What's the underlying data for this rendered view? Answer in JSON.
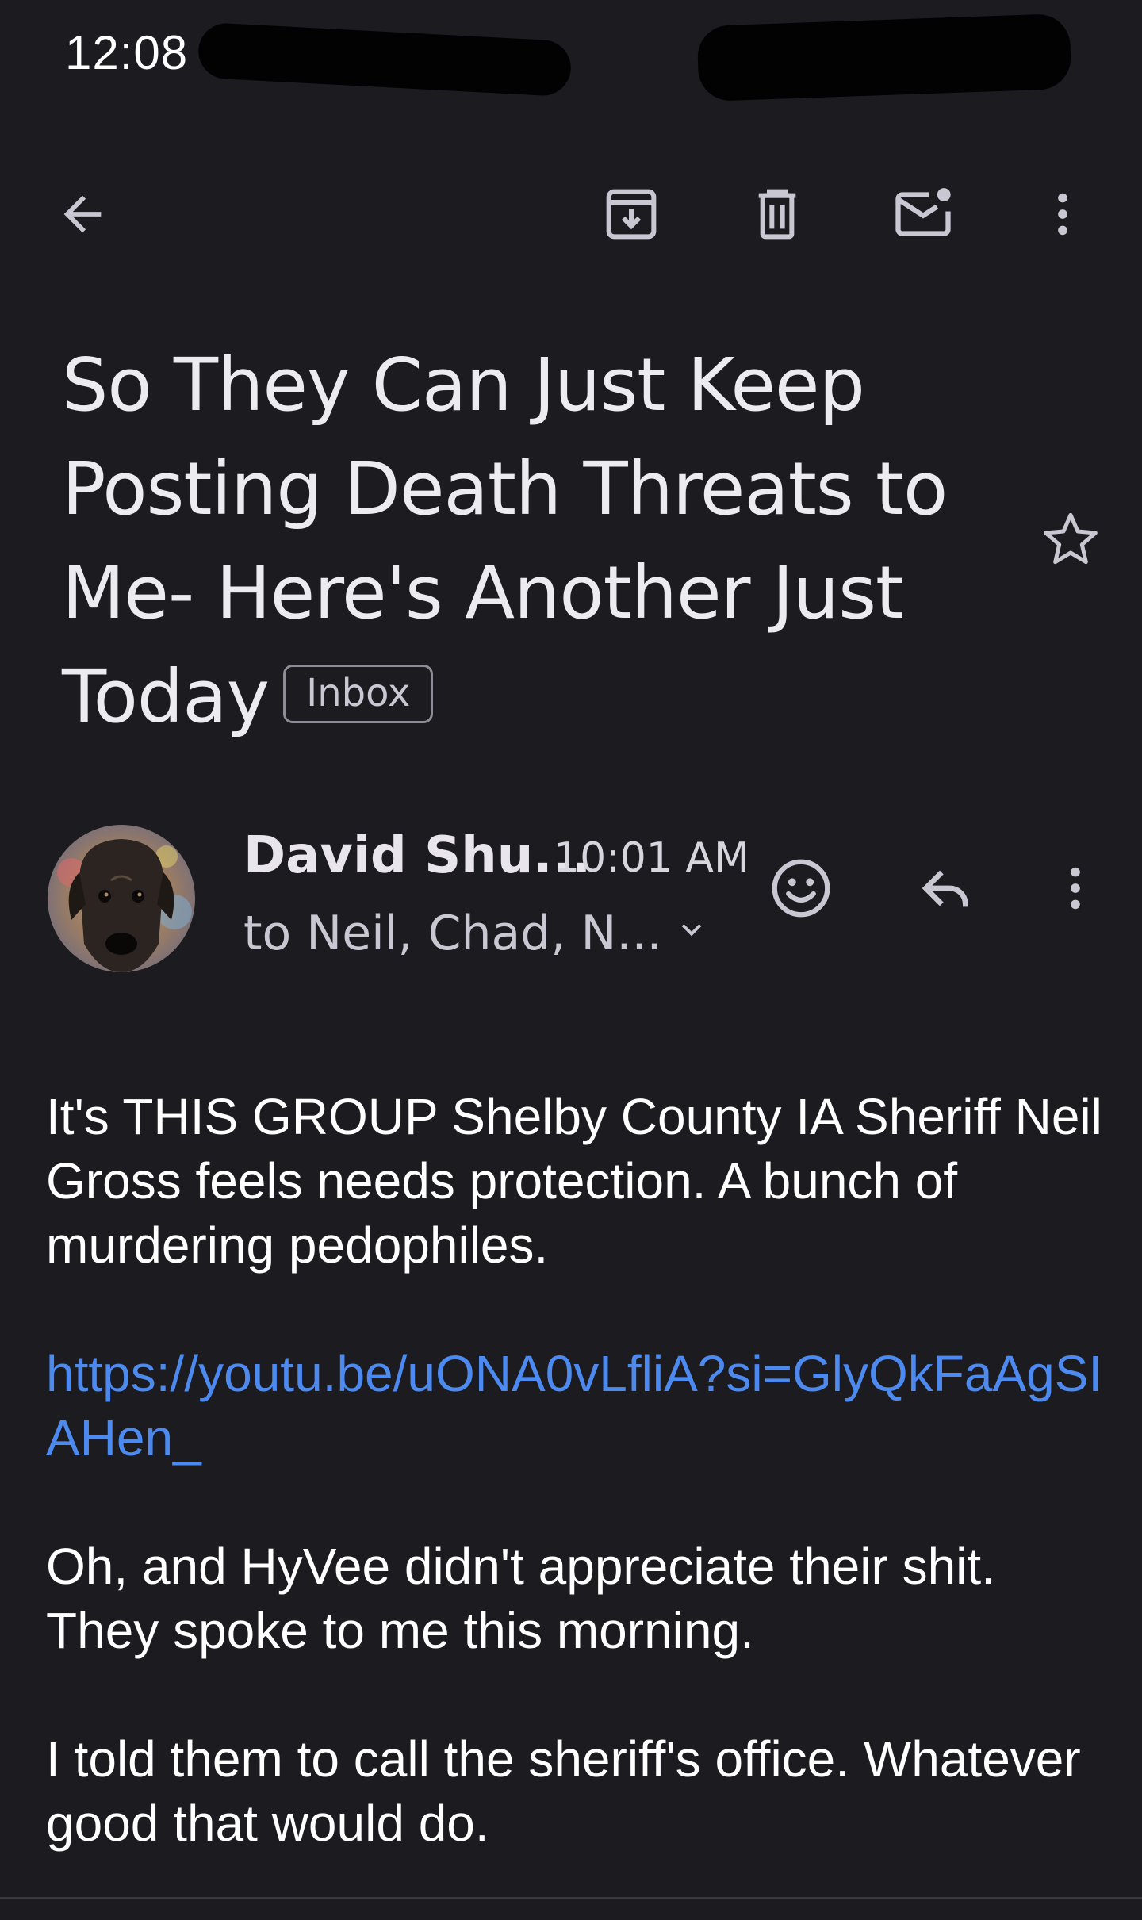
{
  "status_bar": {
    "time": "12:08"
  },
  "toolbar": {
    "back_icon": "arrow-back-icon",
    "archive_icon": "archive-icon",
    "delete_icon": "trash-icon",
    "mark_unread_icon": "mail-unread-icon",
    "more_icon": "more-vert-icon"
  },
  "email": {
    "subject": "So They Can Just Keep Posting Death Threats to Me- Here's Another Just Today",
    "label": "Inbox",
    "starred": false,
    "sender": {
      "name": "David Shu...",
      "time": "10:01 AM",
      "recipients": "to Neil, Chad, N..."
    },
    "body": {
      "paragraph_1": "It's THIS GROUP Shelby County IA Sheriff Neil Gross feels needs protection. A bunch of murdering pedophiles.",
      "link": "https://youtu.be/uONA0vLfliA?si=GlyQkFaAgSIAHen_",
      "paragraph_2": "Oh, and HyVee didn't appreciate their shit. They spoke to me this morning.",
      "paragraph_3": "I told them to call the sheriff's office. Whatever good that would do."
    }
  },
  "colors": {
    "background": "#1b1b20",
    "text": "#ffffff",
    "link": "#4d8af0"
  }
}
